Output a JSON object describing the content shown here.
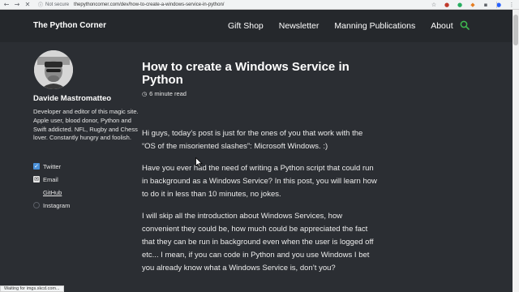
{
  "browser": {
    "back_icon": "back-arrow-icon",
    "forward_icon": "forward-arrow-icon",
    "reload_icon": "reload-icon",
    "security_label": "Not secure",
    "url": "thepythoncorner.com/dev/how-to-create-a-windows-service-in-python/",
    "status_text": "Waiting for imgs.xkcd.com..."
  },
  "header": {
    "brand": "The Python Corner",
    "nav": [
      "Gift Shop",
      "Newsletter",
      "Manning Publications",
      "About"
    ],
    "accent_color": "#3fb950"
  },
  "sidebar": {
    "author": "Davide Mastromatteo",
    "bio": "Developer and editor of this magic site. Apple user, blood donor, Python and Swift addicted. NFL, Rugby and Chess lover. Constantly hungry and foolish.",
    "social": [
      {
        "label": "Twitter",
        "icon": "twitter-icon",
        "color": "#4a90d9"
      },
      {
        "label": "Email",
        "icon": "email-icon",
        "color": "#e6e6e6"
      },
      {
        "label": "GitHub",
        "icon": "github-icon",
        "color": "#2b2e33"
      },
      {
        "label": "Instagram",
        "icon": "instagram-icon",
        "color": "#4a4e55"
      }
    ]
  },
  "article": {
    "title": "How to create a Windows Service in Python",
    "read_time": "6 minute read",
    "paragraphs": [
      "Hi guys, today’s post is just for the ones of you that work with the “OS of the misoriented slashes”: Microsoft Windows. :)",
      "Have you ever had the need of writing a Python script that could run in background as a Windows Service? In this post, you will learn how to do it in less than 10 minutes, no jokes.",
      "I will skip all the introduction about Windows Services, how convenient they could be, how much could be appreciated the fact that they can be run in background even when the user is logged off etc... I mean, if you can code in Python and you use Windows I bet you already know what a Windows Service is, don’t you?"
    ]
  }
}
